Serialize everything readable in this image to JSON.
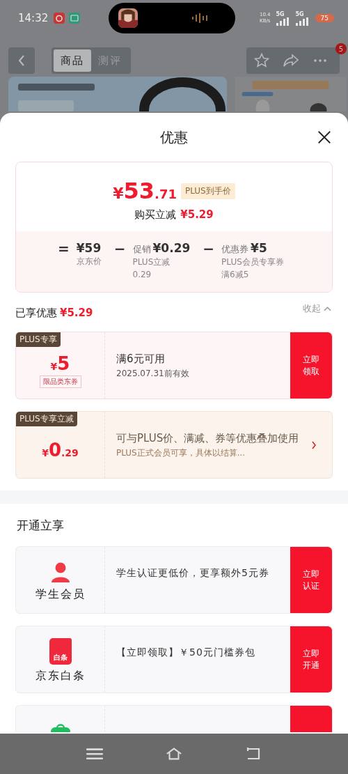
{
  "status_bar": {
    "time": "14:32",
    "net_speed": [
      "10.4",
      "KB/s"
    ],
    "networks": [
      "5G",
      "5G"
    ],
    "battery": "75"
  },
  "top_nav": {
    "tabs": [
      {
        "label": "商品",
        "selected": true
      },
      {
        "label": "测评",
        "selected": false
      }
    ],
    "more_badge": "5"
  },
  "sheet": {
    "title": "优惠"
  },
  "price_summary": {
    "symbol": "¥",
    "integer": "53",
    "decimal": ".71",
    "price_tag": "PLUS到手价",
    "reduction_label": "购买立减",
    "reduction_amount": "¥5.29",
    "breakdown": [
      {
        "operator": "=",
        "amount": "¥59",
        "notes": [
          "京东价"
        ]
      },
      {
        "operator": "−",
        "label": "促销",
        "amount": "¥0.29",
        "notes": [
          "PLUS立减",
          "0.29"
        ]
      },
      {
        "operator": "−",
        "label": "优惠券",
        "amount": "¥5",
        "notes": [
          "PLUS会员专享券",
          "满6减5"
        ]
      }
    ]
  },
  "enjoyed": {
    "label": "已享优惠",
    "amount": "¥5.29",
    "toggle": "收起",
    "expanded": true
  },
  "coupons": [
    {
      "kind": "claim",
      "tag": "PLUS专享",
      "symbol": "¥",
      "integer": "5",
      "type": "限品类东券",
      "title": "满6元可用",
      "subtitle": "2025.07.31前有效",
      "action": "立即领取"
    },
    {
      "kind": "link",
      "tag": "PLUS专享立减",
      "symbol": "¥",
      "integer": "0",
      "decimal": ".29",
      "title": "可与PLUS价、满减、券等优惠叠加使用",
      "subtitle": "PLUS正式会员可享，具体以结算..."
    }
  ],
  "open_section": {
    "title": "开通立享",
    "offers": [
      {
        "kind": "student",
        "name": "学生会员",
        "description": "学生认证更低价，更享额外5元券",
        "action": "立即认证"
      },
      {
        "kind": "baitiao",
        "icon_text": "白条",
        "name": "京东白条",
        "description": "【立即领取】￥50元门槛券包",
        "action": "立即开通"
      },
      {
        "kind": "wallet"
      }
    ]
  }
}
